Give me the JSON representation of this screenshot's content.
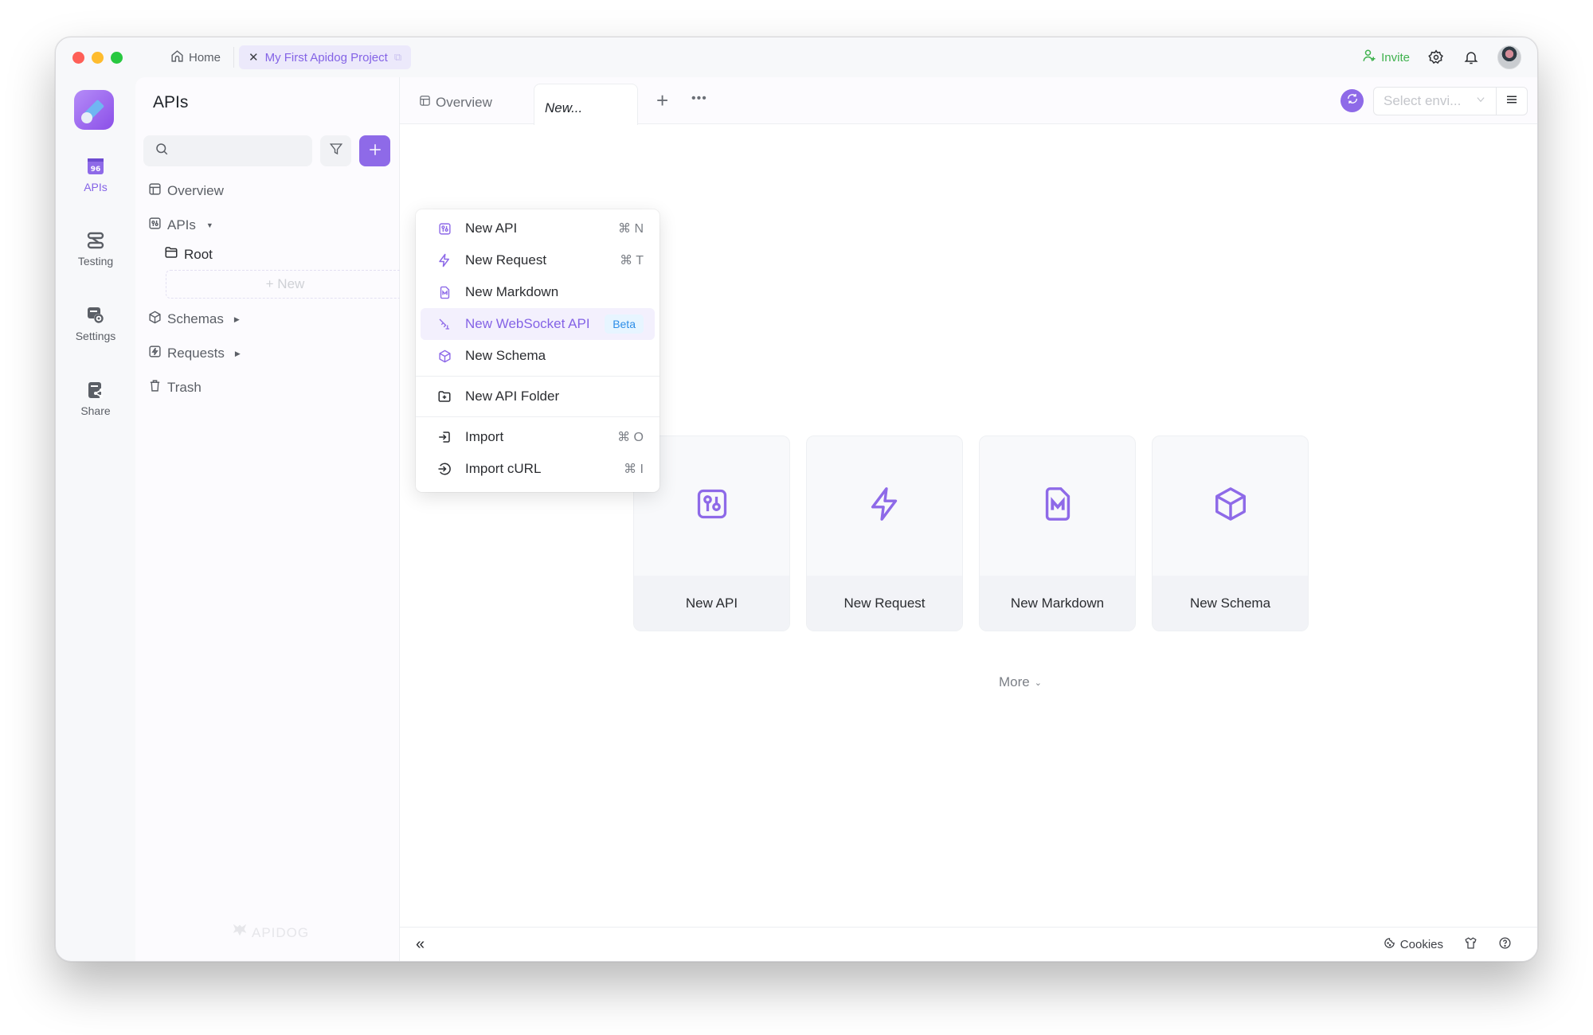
{
  "titlebar": {
    "home_label": "Home",
    "project_tab_label": "My First Apidog Project",
    "invite_label": "Invite",
    "icons": [
      "home-icon",
      "close-icon",
      "external-link-icon",
      "add-user-icon",
      "gear-icon",
      "bell-icon",
      "avatar"
    ]
  },
  "rail": {
    "items": [
      {
        "label": "APIs",
        "icon": "apis-icon",
        "active": true
      },
      {
        "label": "Testing",
        "icon": "testing-icon",
        "active": false
      },
      {
        "label": "Settings",
        "icon": "settings-icon",
        "active": false
      },
      {
        "label": "Share",
        "icon": "share-icon",
        "active": false
      }
    ]
  },
  "sidebar": {
    "title": "APIs",
    "search_placeholder": "",
    "tree": {
      "overview": "Overview",
      "apis": "APIs",
      "root": "Root",
      "new_placeholder": "+ New",
      "schemas": "Schemas",
      "requests": "Requests",
      "trash": "Trash"
    },
    "watermark": "APIDOG"
  },
  "tabs": {
    "overview": "Overview",
    "active": "New...",
    "add": "+",
    "more": "•••"
  },
  "environment": {
    "placeholder": "Select envi...",
    "value": ""
  },
  "cards": [
    {
      "label": "New API",
      "icon": "api-icon"
    },
    {
      "label": "New Request",
      "icon": "lightning-icon"
    },
    {
      "label": "New Markdown",
      "icon": "markdown-icon"
    },
    {
      "label": "New Schema",
      "icon": "cube-icon"
    }
  ],
  "more_label": "More",
  "statusbar": {
    "collapse": "«",
    "cookies_label": "Cookies"
  },
  "dropdown": {
    "items": [
      {
        "label": "New API",
        "shortcut": "⌘ N"
      },
      {
        "label": "New Request",
        "shortcut": "⌘ T"
      },
      {
        "label": "New Markdown",
        "shortcut": ""
      },
      {
        "label": "New WebSocket API",
        "badge": "Beta",
        "highlighted": true
      },
      {
        "label": "New Schema",
        "shortcut": ""
      },
      {
        "label": "New API Folder",
        "shortcut": ""
      },
      {
        "label": "Import",
        "shortcut": "⌘ O"
      },
      {
        "label": "Import cURL",
        "shortcut": "⌘ I"
      }
    ]
  },
  "colors": {
    "accent": "#8e6ae8",
    "invite_green": "#3fb24e",
    "beta_blue": "#2d8ee8"
  }
}
